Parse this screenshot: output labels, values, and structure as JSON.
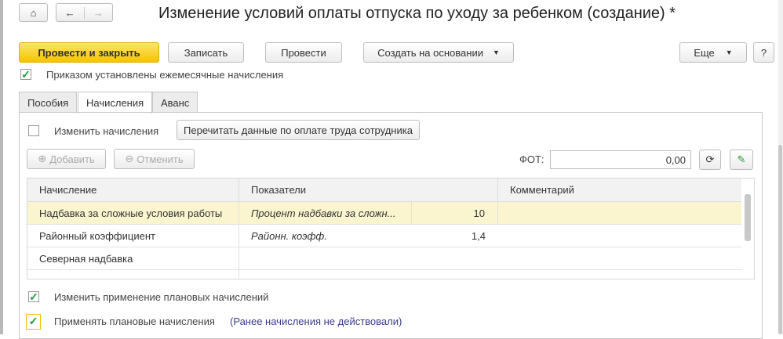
{
  "title": "Изменение условий оплаты отпуска по уходу за ребенком (создание) *",
  "toolbar": {
    "post_close": "Провести и закрыть",
    "save": "Записать",
    "post": "Провести",
    "create_based": "Создать на основании",
    "more": "Еще",
    "help": "?"
  },
  "monthly_accruals": {
    "label": "Приказом установлены ежемесячные начисления",
    "checked": true
  },
  "tabs": [
    {
      "label": "Пособия"
    },
    {
      "label": "Начисления",
      "active": true
    },
    {
      "label": "Аванс"
    }
  ],
  "change_accruals": {
    "label": "Изменить начисления",
    "checked": false
  },
  "reread_button": "Перечитать данные по оплате труда сотрудника",
  "add_button": "Добавить",
  "cancel_button": "Отменить",
  "fot": {
    "label": "ФОТ:",
    "value": "0,00"
  },
  "grid": {
    "headers": [
      "Начисление",
      "Показатели",
      "Комментарий"
    ],
    "rows": [
      {
        "accrual": "Надбавка за сложные условия работы",
        "indicator": "Процент надбавки за сложн...",
        "value": "10",
        "comment": ""
      },
      {
        "accrual": "Районный коэффициент",
        "indicator": "Районн. коэфф.",
        "value": "1,4",
        "comment": ""
      },
      {
        "accrual": "Северная надбавка",
        "indicator": "",
        "value": "",
        "comment": ""
      }
    ]
  },
  "change_planned": {
    "label": "Изменить применение плановых начислений",
    "checked": true
  },
  "apply_planned": {
    "label": "Применять плановые начисления",
    "note": "(Ранее начисления не действовали)",
    "checked": true
  }
}
